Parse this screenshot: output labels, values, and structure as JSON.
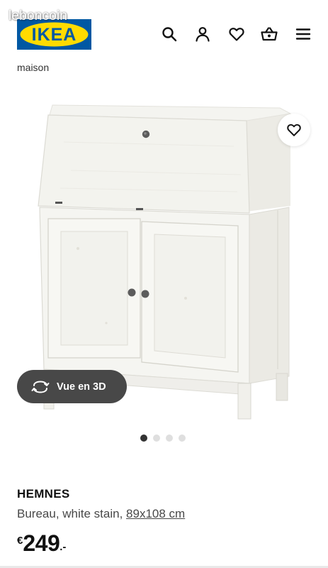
{
  "watermark": {
    "text": "leboncoin"
  },
  "header": {
    "logo_text": "IKEA",
    "icons": [
      "search-icon",
      "user-icon",
      "heart-icon",
      "basket-icon",
      "menu-icon"
    ]
  },
  "peek": {
    "text": "maison"
  },
  "gallery": {
    "view_3d_label": "Vue en 3D",
    "slide_count": 4,
    "active_slide": 1
  },
  "product": {
    "name": "HEMNES",
    "description": "Bureau, white stain, ",
    "dimensions": "89x108 cm",
    "price": {
      "currency": "€",
      "integer": "249",
      "decimal": ".-"
    }
  },
  "colors": {
    "ikea_blue": "#0058a3",
    "ikea_yellow": "#ffdb00",
    "view3d_bg": "#484848",
    "dot_active": "#333333",
    "dot_inactive": "#dfdfdf"
  }
}
